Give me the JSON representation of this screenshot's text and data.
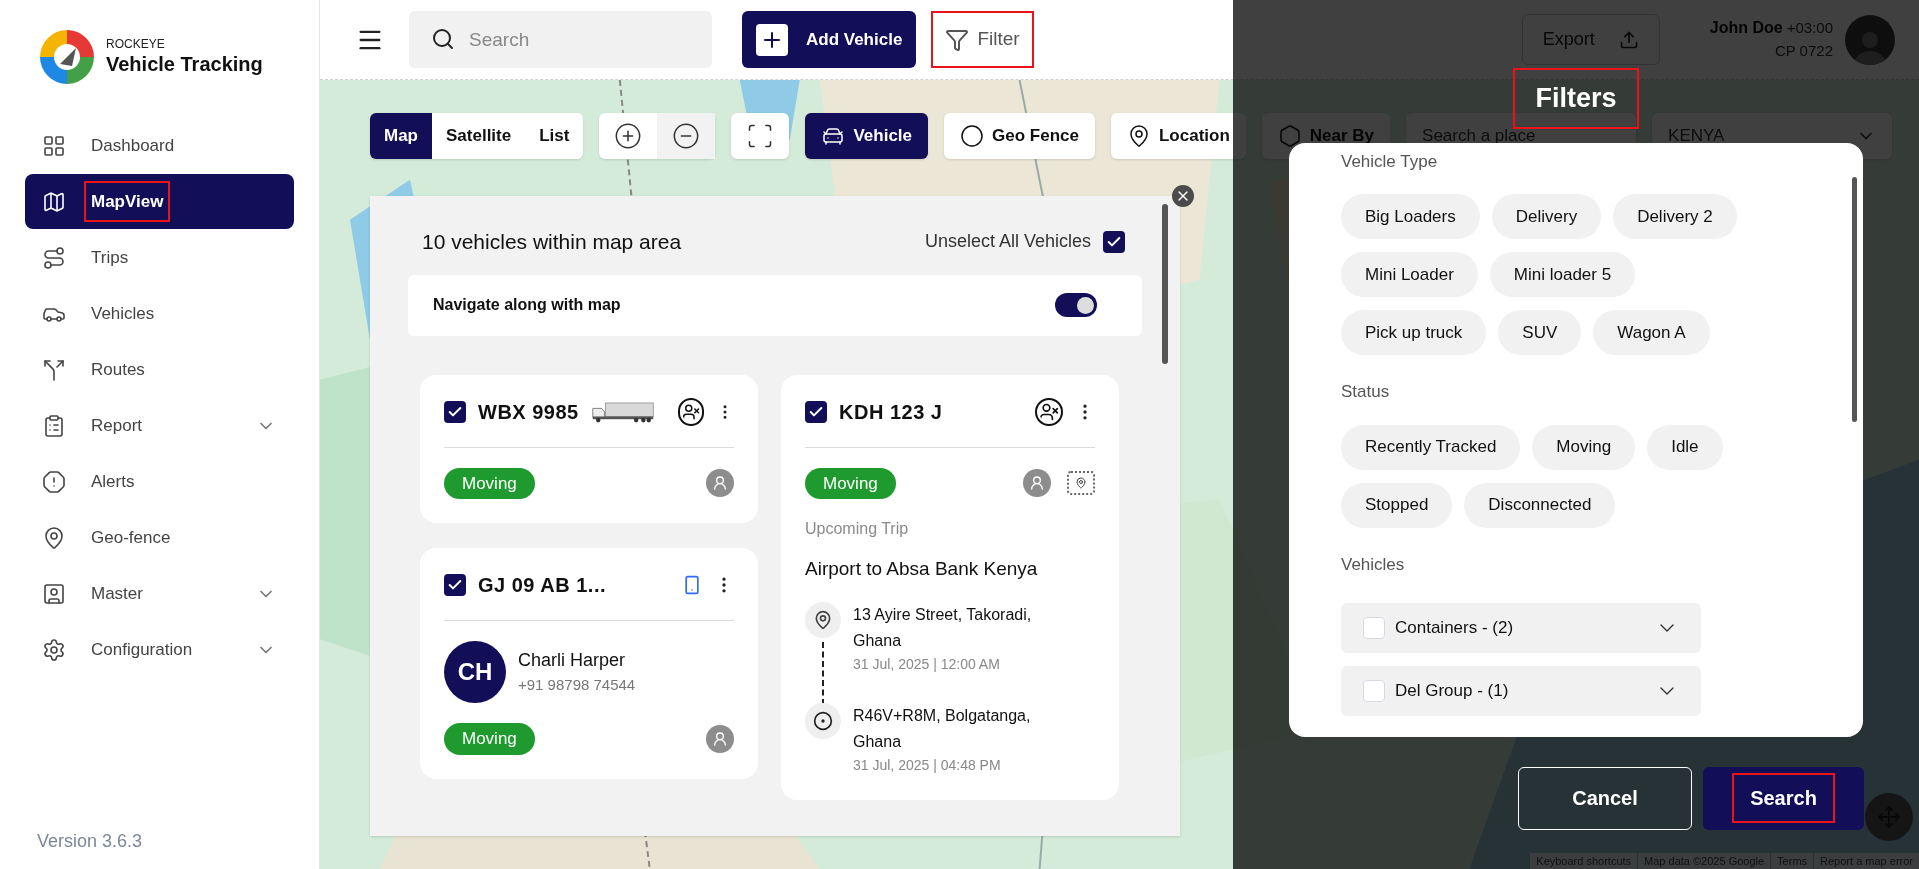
{
  "sidebar": {
    "brand_top": "ROCKEYE",
    "brand": "Vehicle Tracking",
    "items": [
      {
        "label": "Dashboard",
        "selected": false,
        "highlighted": false
      },
      {
        "label": "MapView",
        "selected": true,
        "highlighted": true
      },
      {
        "label": "Trips",
        "selected": false,
        "highlighted": false
      },
      {
        "label": "Vehicles",
        "selected": false,
        "highlighted": false
      },
      {
        "label": "Routes",
        "selected": false,
        "highlighted": false
      },
      {
        "label": "Report",
        "selected": false,
        "highlighted": false,
        "expanded": false
      },
      {
        "label": "Alerts",
        "selected": false,
        "highlighted": false
      },
      {
        "label": "Geo-fence",
        "selected": false,
        "highlighted": false
      },
      {
        "label": "Master",
        "selected": false,
        "highlighted": false,
        "expanded": false
      },
      {
        "label": "Configuration",
        "selected": false,
        "highlighted": false,
        "expanded": false
      }
    ],
    "version": "Version 3.6.3"
  },
  "topbar": {
    "search": {
      "placeholder": "Search"
    },
    "add_button": "Add Vehicle",
    "filter_button": {
      "label": "Filter",
      "highlighted": true
    },
    "export_button": "Export",
    "user": {
      "name": "John Doe",
      "timezone": "+03:00",
      "code": "CP 0722"
    }
  },
  "map_controls": {
    "view_tabs": [
      {
        "label": "Map",
        "selected": true
      },
      {
        "label": "Satellite",
        "selected": false
      },
      {
        "label": "List",
        "selected": false
      }
    ],
    "layers": [
      {
        "label": "Vehicle",
        "selected": true
      },
      {
        "label": "Geo Fence",
        "selected": false
      },
      {
        "label": "Location",
        "selected": false
      },
      {
        "label": "Near By",
        "selected": false
      }
    ],
    "place_search": {
      "placeholder": "Search a place"
    },
    "country": "KENYA"
  },
  "vehicle_panel": {
    "title": "10 vehicles within map area",
    "unselect_all": {
      "label": "Unselect All Vehicles",
      "checked": true
    },
    "navigate": {
      "label": "Navigate along with map",
      "on": true
    },
    "columns": [
      [
        {
          "plate": "WBX 9985",
          "checked": true,
          "kind": "unassigned",
          "vehicle_image": true,
          "status": "Moving"
        },
        {
          "plate": "GJ 09 AB 1...",
          "checked": true,
          "kind": "driver",
          "vehicle_image": false,
          "status": "Moving",
          "driver": {
            "initials": "CH",
            "name": "Charli Harper",
            "phone": "+91 98798 74544"
          }
        }
      ],
      [
        {
          "plate": "KDH 123 J",
          "checked": true,
          "kind": "unassigned",
          "vehicle_image": false,
          "status": "Moving",
          "trip": {
            "heading": "Upcoming Trip",
            "name": "Airport to Absa Bank Kenya",
            "stops": [
              {
                "address": "13 Ayire Street, Takoradi, Ghana",
                "time": "31 Jul, 2025 | 12:00 AM"
              },
              {
                "address": "R46V+R8M, Bolgatanga, Ghana",
                "time": "31 Jul, 2025 | 04:48 PM"
              }
            ]
          }
        }
      ]
    ]
  },
  "filters": {
    "title": "Filters",
    "highlighted": true,
    "sections": [
      {
        "kind": "chips",
        "title": "Vehicle Type",
        "options": [
          {
            "label": "Big Loaders",
            "selected": false
          },
          {
            "label": "Delivery",
            "selected": false
          },
          {
            "label": "Delivery 2",
            "selected": false
          },
          {
            "label": "Mini Loader",
            "selected": false
          },
          {
            "label": "Mini loader 5",
            "selected": false
          },
          {
            "label": "Pick up truck",
            "selected": false
          },
          {
            "label": "SUV",
            "selected": false
          },
          {
            "label": "Wagon A",
            "selected": false
          }
        ]
      },
      {
        "kind": "chips",
        "title": "Status",
        "options": [
          {
            "label": "Recently Tracked",
            "selected": false
          },
          {
            "label": "Moving",
            "selected": false
          },
          {
            "label": "Idle",
            "selected": false
          },
          {
            "label": "Stopped",
            "selected": false
          },
          {
            "label": "Disconnected",
            "selected": false
          }
        ]
      },
      {
        "kind": "groups",
        "title": "Vehicles",
        "groups": [
          {
            "label": "Containers - (2)",
            "checked": false
          },
          {
            "label": "Del Group - (1)",
            "checked": false
          }
        ]
      }
    ],
    "cancel": "Cancel",
    "search": {
      "label": "Search",
      "highlighted": true
    }
  },
  "map_footer": [
    "Keyboard shortcuts",
    "Map data ©2025 Google",
    "Terms",
    "Report a map error"
  ]
}
